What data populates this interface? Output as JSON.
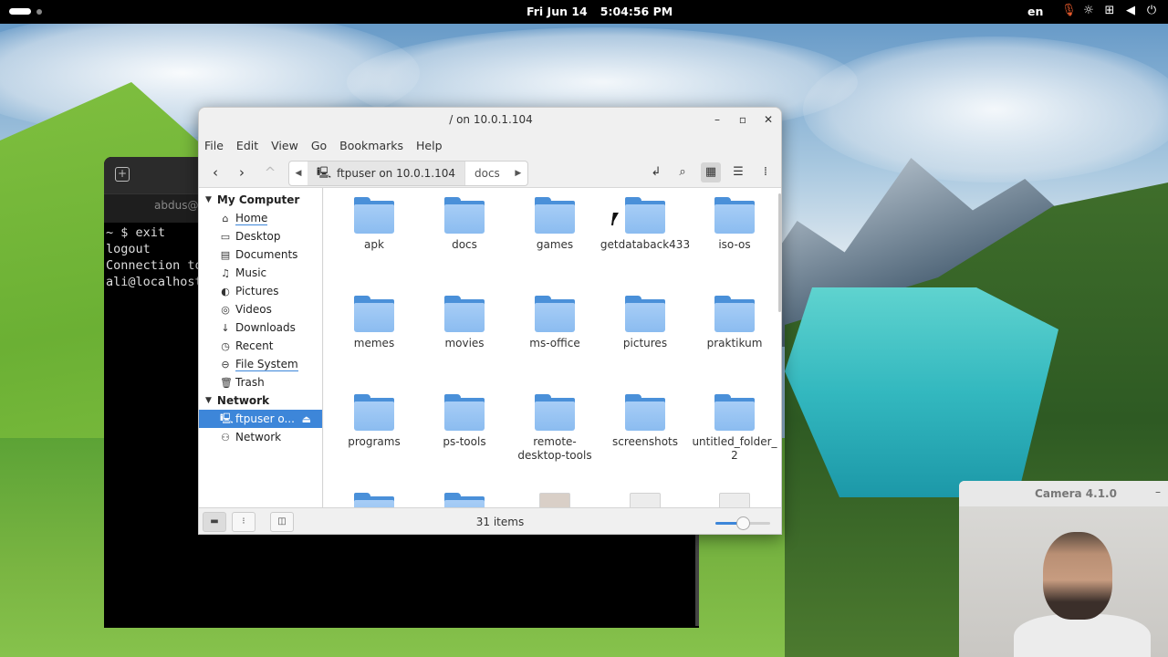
{
  "topbar": {
    "date": "Fri Jun 14",
    "time": "5:04:56 PM",
    "language": "en",
    "tray_icons": [
      "microphone-icon",
      "brightness-icon",
      "network-icon",
      "volume-icon",
      "power-icon"
    ]
  },
  "terminal": {
    "tab_title": "abdus@l",
    "lines": [
      "~ $ exit",
      "logout",
      "Connection to",
      "ali@localhost"
    ]
  },
  "file_manager": {
    "window_title": "/ on 10.0.1.104",
    "menu": [
      "File",
      "Edit",
      "View",
      "Go",
      "Bookmarks",
      "Help"
    ],
    "path": {
      "current": "ftpuser on 10.0.1.104",
      "next": "docs"
    },
    "sidebar": {
      "my_computer_label": "My Computer",
      "my_computer_items": [
        {
          "label": "Home",
          "icon": "home-icon"
        },
        {
          "label": "Desktop",
          "icon": "desktop-folder-icon"
        },
        {
          "label": "Documents",
          "icon": "documents-icon"
        },
        {
          "label": "Music",
          "icon": "music-icon"
        },
        {
          "label": "Pictures",
          "icon": "pictures-icon"
        },
        {
          "label": "Videos",
          "icon": "videos-icon"
        },
        {
          "label": "Downloads",
          "icon": "downloads-icon"
        },
        {
          "label": "Recent",
          "icon": "recent-icon"
        },
        {
          "label": "File System",
          "icon": "filesystem-icon"
        },
        {
          "label": "Trash",
          "icon": "trash-icon"
        }
      ],
      "network_label": "Network",
      "network_items": [
        {
          "label": "ftpuser o...",
          "icon": "network-drive-icon",
          "selected": true
        },
        {
          "label": "Network",
          "icon": "network-icon"
        }
      ]
    },
    "files": [
      {
        "name": "apk",
        "type": "folder"
      },
      {
        "name": "docs",
        "type": "folder"
      },
      {
        "name": "games",
        "type": "folder"
      },
      {
        "name": "getdataback433",
        "type": "folder"
      },
      {
        "name": "iso-os",
        "type": "folder"
      },
      {
        "name": "memes",
        "type": "folder"
      },
      {
        "name": "movies",
        "type": "folder"
      },
      {
        "name": "ms-office",
        "type": "folder"
      },
      {
        "name": "pictures",
        "type": "folder"
      },
      {
        "name": "praktikum",
        "type": "folder"
      },
      {
        "name": "programs",
        "type": "folder"
      },
      {
        "name": "ps-tools",
        "type": "folder"
      },
      {
        "name": "remote-desktop-tools",
        "type": "folder",
        "label_lines": [
          "remote-",
          "desktop-tools"
        ]
      },
      {
        "name": "screenshots",
        "type": "folder"
      },
      {
        "name": "untitled_folder_2",
        "type": "folder",
        "label_lines": [
          "untitled_folder_",
          "2"
        ]
      },
      {
        "name": "",
        "type": "folder"
      },
      {
        "name": "",
        "type": "folder"
      },
      {
        "name": "",
        "type": "package"
      },
      {
        "name": "",
        "type": "document"
      },
      {
        "name": "",
        "type": "document"
      }
    ],
    "status": {
      "item_count": "31 items",
      "zoom_level": 0.5
    }
  },
  "camera": {
    "title": "Camera 4.1.0"
  },
  "colors": {
    "accent": "#3d86d9",
    "folder": "#8bbcf0"
  }
}
